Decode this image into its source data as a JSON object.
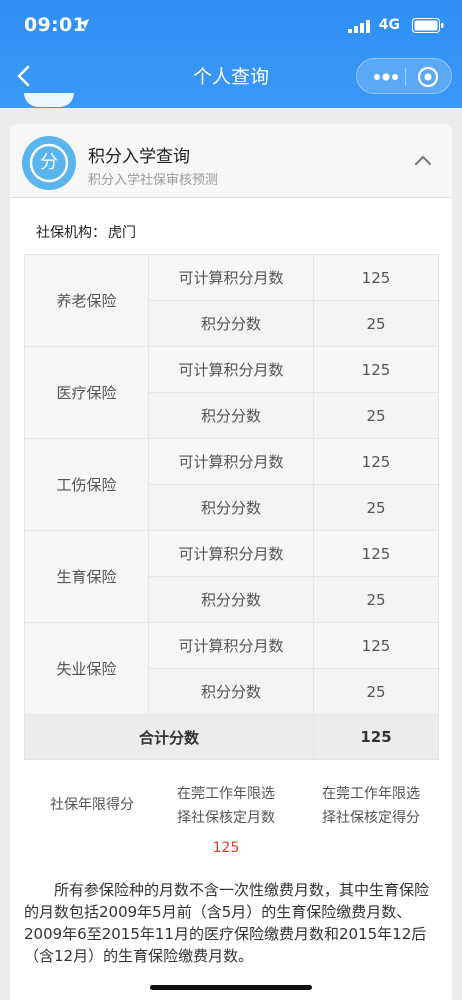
{
  "status_bar": {
    "time": "09:01",
    "network": "4G"
  },
  "nav": {
    "title": "个人查询"
  },
  "card": {
    "logo_char": "分",
    "title": "积分入学查询",
    "subtitle": "积分入学社保审核预测"
  },
  "org": {
    "label": "社保机构：",
    "value": "虎门"
  },
  "insurance": [
    {
      "type": "养老保险",
      "months_label": "可计算积分月数",
      "months": "125",
      "score_label": "积分分数",
      "score": "25"
    },
    {
      "type": "医疗保险",
      "months_label": "可计算积分月数",
      "months": "125",
      "score_label": "积分分数",
      "score": "25"
    },
    {
      "type": "工伤保险",
      "months_label": "可计算积分月数",
      "months": "125",
      "score_label": "积分分数",
      "score": "25"
    },
    {
      "type": "生育保险",
      "months_label": "可计算积分月数",
      "months": "125",
      "score_label": "积分分数",
      "score": "25"
    },
    {
      "type": "失业保险",
      "months_label": "可计算积分月数",
      "months": "125",
      "score_label": "积分分数",
      "score": "25"
    }
  ],
  "total": {
    "label": "合计分数",
    "value": "125"
  },
  "years_score": {
    "label": "社保年限得分",
    "col1_line1": "在莞工作年限选",
    "col1_line2": "择社保核定月数",
    "col2_line1": "在莞工作年限选",
    "col2_line2": "择社保核定得分",
    "value": "125"
  },
  "note": "所有参保险种的月数不含一次性缴费月数，其中生育保险的月数包括2009年5月前（含5月）的生育保险缴费月数、2009年6至2015年11月的医疗保险缴费月数和2015年12后（含12月）的生育保险缴费月数。",
  "colors": {
    "primary": "#2f8ff3",
    "accent_red": "#d9432b"
  }
}
